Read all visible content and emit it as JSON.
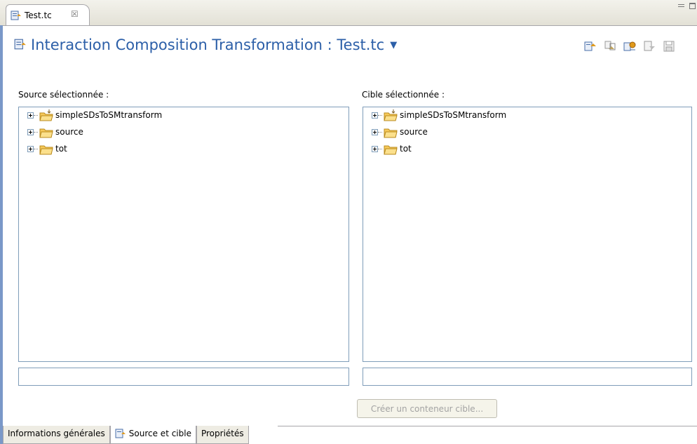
{
  "editor_tab": {
    "label": "Test.tc",
    "close_symbol": "☒"
  },
  "header": {
    "title": "Interaction Composition Transformation : Test.tc",
    "dropdown_symbol": "▼",
    "toolbar_icons": [
      "source-target-icon",
      "swap-icon",
      "transform-icon",
      "export-icon",
      "save-icon"
    ]
  },
  "source": {
    "label": "Source sélectionnée :",
    "items": [
      {
        "label": "simpleSDsToSMtransform",
        "icon": "project-folder-icon"
      },
      {
        "label": "source",
        "icon": "folder-icon"
      },
      {
        "label": "tot",
        "icon": "folder-icon"
      }
    ],
    "field_value": ""
  },
  "target": {
    "label": "Cible sélectionnée :",
    "items": [
      {
        "label": "simpleSDsToSMtransform",
        "icon": "project-folder-icon"
      },
      {
        "label": "source",
        "icon": "folder-icon"
      },
      {
        "label": "tot",
        "icon": "folder-icon"
      }
    ],
    "field_value": ""
  },
  "create_button": {
    "label": "Créer un conteneur cible...",
    "enabled": false
  },
  "bottom_tabs": [
    {
      "label": "Informations générales",
      "active": false
    },
    {
      "label": "Source et cible",
      "active": true
    },
    {
      "label": "Propriétés",
      "active": false
    }
  ],
  "colors": {
    "title": "#2c5fa8",
    "frame_accent": "#7a98c8",
    "tree_border": "#7f9db9"
  }
}
